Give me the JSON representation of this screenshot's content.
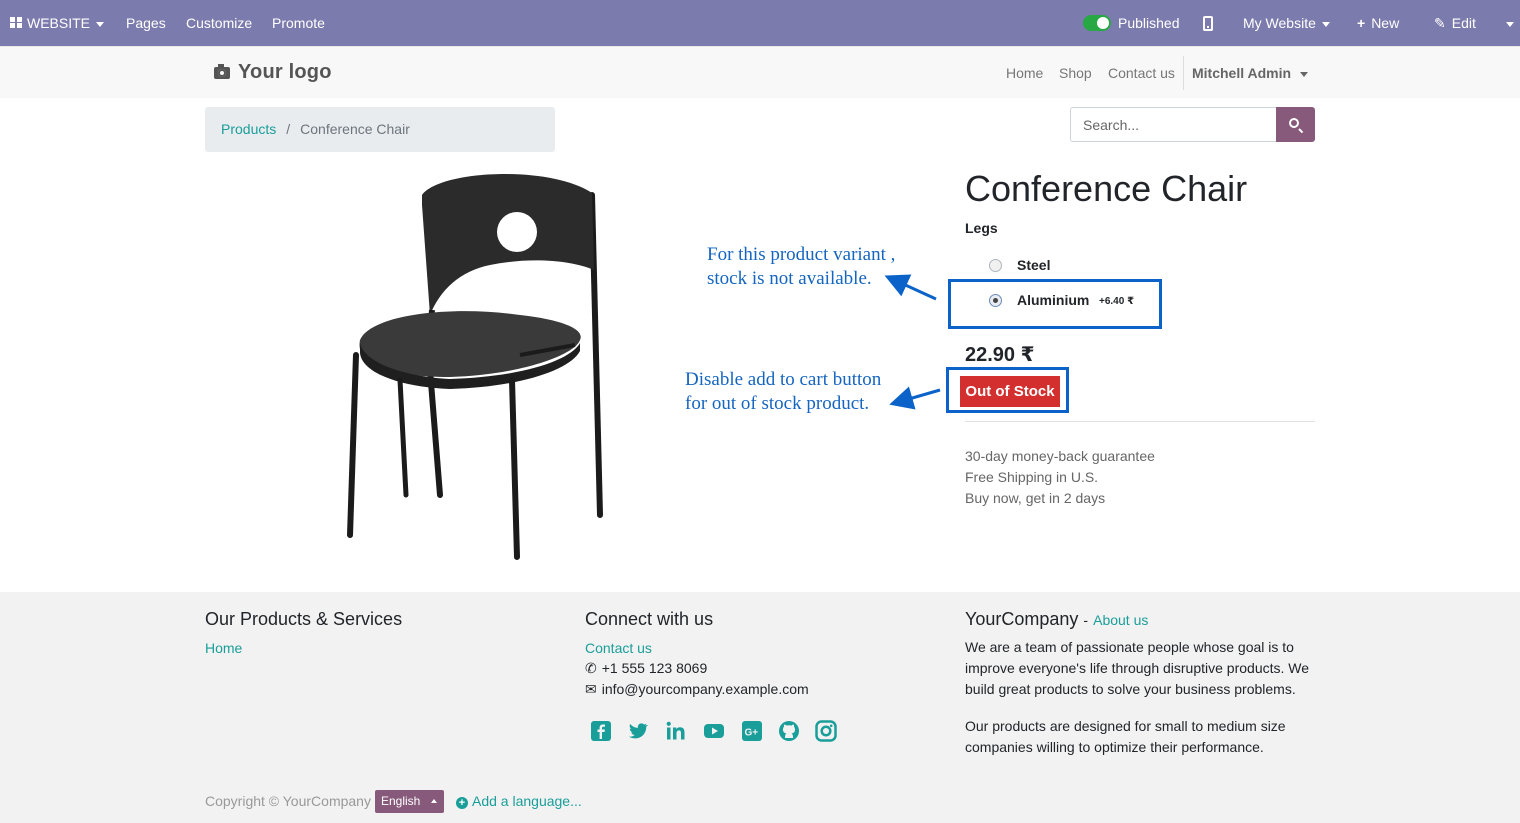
{
  "adminbar": {
    "apps_label": "WEBSITE",
    "menu": [
      "Pages",
      "Customize",
      "Promote"
    ],
    "published_label": "Published",
    "website_label": "My Website",
    "new_label": "New",
    "edit_label": "Edit",
    "bar_color": "#7c7bad"
  },
  "header": {
    "logo_text": "Your logo",
    "nav": [
      "Home",
      "Shop",
      "Contact us"
    ],
    "user": "Mitchell Admin"
  },
  "breadcrumb": {
    "parent": "Products",
    "separator": "/",
    "current": "Conference Chair"
  },
  "search": {
    "placeholder": "Search..."
  },
  "product": {
    "name": "Conference Chair",
    "attribute_label": "Legs",
    "options": [
      {
        "label": "Steel",
        "extra": "",
        "selected": false
      },
      {
        "label": "Aluminium",
        "extra": "+6.40 ₹",
        "selected": true
      }
    ],
    "price": "22.90 ₹",
    "stock_button": "Out of Stock",
    "benefits": [
      "30-day money-back guarantee",
      "Free Shipping in U.S.",
      "Buy now, get in 2 days"
    ],
    "stock_button_color": "#d32f2f"
  },
  "annotations": {
    "variant_note": [
      "For this product variant  ,",
      "stock is not available."
    ],
    "cart_note": [
      "Disable add to cart button",
      "for out of stock product."
    ],
    "color": "#0b63c9"
  },
  "footer": {
    "col1_title": "Our Products & Services",
    "col1_links": [
      "Home"
    ],
    "col2_title": "Connect with us",
    "col2_link": "Contact us",
    "phone": "+1 555 123 8069",
    "email": "info@yourcompany.example.com",
    "social_icons": [
      "facebook-icon",
      "twitter-icon",
      "linkedin-icon",
      "youtube-icon",
      "google-plus-icon",
      "github-icon",
      "instagram-icon"
    ],
    "col3_title": "YourCompany",
    "col3_title_sep": "-",
    "col3_link": "About us",
    "col3_p1": "We are a team of passionate people whose goal is to improve everyone's life through disruptive products. We build great products to solve your business problems.",
    "col3_p2": "Our products are designed for small to medium size companies willing to optimize their performance.",
    "copyright": "Copyright © YourCompany",
    "language": "English",
    "add_language": "Add a language...",
    "accent_color": "#1a9e9a"
  }
}
